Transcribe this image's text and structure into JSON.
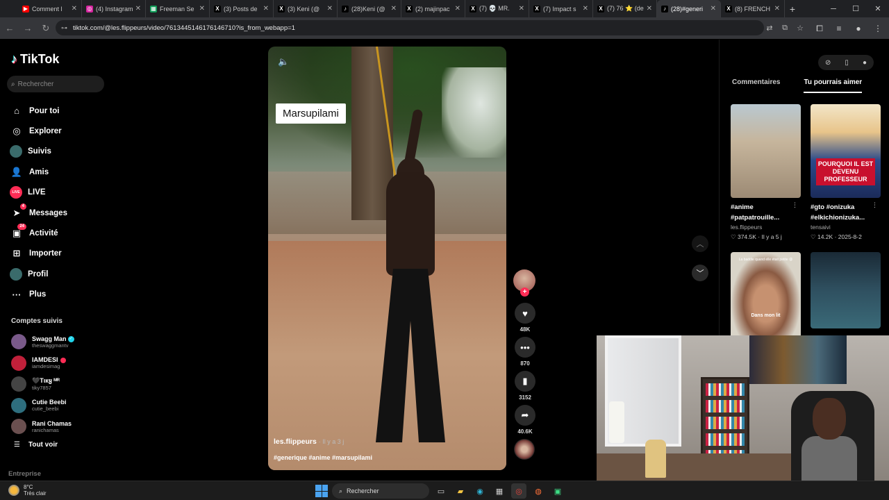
{
  "browser": {
    "tabs": [
      {
        "label": "Comment l",
        "favicon": "youtube-icon",
        "color": "#ff0000",
        "glyph": "▶"
      },
      {
        "label": "(4) Instagram",
        "favicon": "instagram-icon",
        "color": "#d6249f",
        "glyph": "◎"
      },
      {
        "label": "Freeman Se",
        "favicon": "sheets-icon",
        "color": "#0f9d58",
        "glyph": "▦"
      },
      {
        "label": "(3) Posts de",
        "favicon": "x-icon",
        "color": "#000000",
        "glyph": "X"
      },
      {
        "label": "(3) Keni (@",
        "favicon": "x-icon",
        "color": "#000000",
        "glyph": "X"
      },
      {
        "label": "(28)Keni (@",
        "favicon": "tiktok-icon",
        "color": "#000000",
        "glyph": "♪"
      },
      {
        "label": "(2) majinpac",
        "favicon": "x-icon",
        "color": "#000000",
        "glyph": "X"
      },
      {
        "label": "(7) 💀 MR.",
        "favicon": "x-icon",
        "color": "#000000",
        "glyph": "X"
      },
      {
        "label": "(7) Impact s",
        "favicon": "x-icon",
        "color": "#000000",
        "glyph": "X"
      },
      {
        "label": "(7) 76 ⭐ (de",
        "favicon": "x-icon",
        "color": "#000000",
        "glyph": "X"
      },
      {
        "label": "(28)#generi",
        "favicon": "tiktok-icon",
        "color": "#000000",
        "glyph": "♪",
        "active": true
      },
      {
        "label": "(8) FRENCH",
        "favicon": "x-icon",
        "color": "#000000",
        "glyph": "X"
      }
    ],
    "url": "tiktok.com/@les.flippeurs/video/7613445146176146710?is_from_webapp=1"
  },
  "sidebar": {
    "logo": "TikTok",
    "search_placeholder": "Rechercher",
    "menu": [
      {
        "label": "Pour toi",
        "icon": "home-icon",
        "glyph": "⌂"
      },
      {
        "label": "Explorer",
        "icon": "compass-icon",
        "glyph": "◎"
      },
      {
        "label": "Suivis",
        "icon": "following-avatar-icon",
        "glyph": ""
      },
      {
        "label": "Amis",
        "icon": "friends-icon",
        "glyph": "👤"
      },
      {
        "label": "LIVE",
        "icon": "live-icon",
        "glyph": "LIVE"
      },
      {
        "label": "Messages",
        "icon": "messages-icon",
        "glyph": "➤",
        "badge": "4"
      },
      {
        "label": "Activité",
        "icon": "activity-icon",
        "glyph": "▣",
        "badge": "24"
      },
      {
        "label": "Importer",
        "icon": "upload-icon",
        "glyph": "⊞"
      },
      {
        "label": "Profil",
        "icon": "profile-avatar-icon",
        "glyph": ""
      },
      {
        "label": "Plus",
        "icon": "more-icon",
        "glyph": "···"
      }
    ],
    "following_title": "Comptes suivis",
    "following": [
      {
        "name": "Swagg Man",
        "handle": "theswaggmantv",
        "verified": true,
        "color": "#7a5a8a"
      },
      {
        "name": "IAMDESI",
        "handle": "iamdesimag",
        "red": true,
        "color": "#c0203a"
      },
      {
        "name": "🖤Tιкყ ᴹᴿ",
        "handle": "tiky7857",
        "color": "#444444"
      },
      {
        "name": "Cutie Beebi",
        "handle": "cutie_beebi",
        "color": "#2e6e7e"
      },
      {
        "name": "Rani Chamas",
        "handle": "ranichamas",
        "color": "#6b5050"
      }
    ],
    "see_all": "Tout voir",
    "company": "Entreprise"
  },
  "video": {
    "caption_chip": "Marsupilami",
    "author": "les.flippeurs",
    "time": "· Il y a 3 j",
    "tags": "#generique #anime #marsupilami"
  },
  "actions": {
    "likes": "48K",
    "comments": "870",
    "saves": "3152",
    "shares": "40.6K"
  },
  "right": {
    "tab_comments": "Commentaires",
    "tab_suggested": "Tu pourrais aimer",
    "cards": [
      {
        "tags": "#anime #patpatrouille...",
        "author": "les.flippeurs",
        "likes": "♡ 374.5K",
        "date": "· Il y a 5 j"
      },
      {
        "tags": "#gto #onizuka #elkichionizuka...",
        "author": "tensaivi",
        "likes": "♡ 14.2K",
        "date": "· 2025-8-2"
      },
      {
        "overlay_top": "La baddie quand elle était petite 😩",
        "overlay": "Dans mon lit"
      },
      {
        "overlay": ""
      }
    ],
    "poster_text": "POURQUOI IL EST DEVENU PROFESSEUR"
  },
  "taskbar": {
    "temp": "8°C",
    "weather": "Très clair",
    "search": "Rechercher"
  }
}
